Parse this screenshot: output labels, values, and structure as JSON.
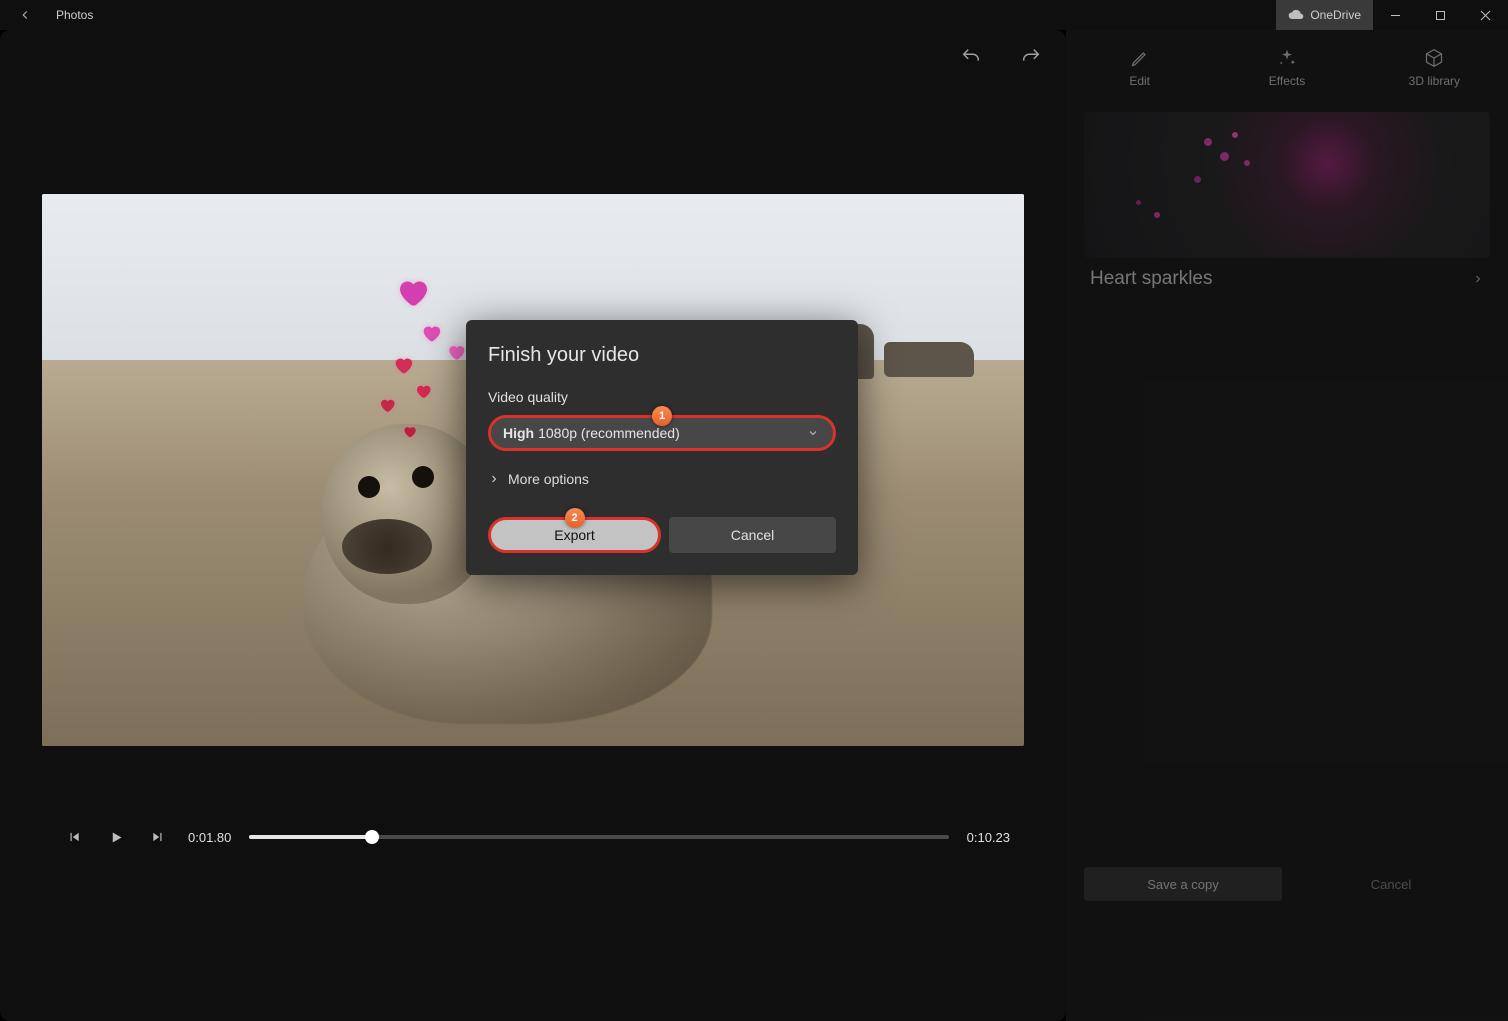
{
  "titlebar": {
    "app_name": "Photos",
    "cloud_label": "OneDrive"
  },
  "toolbar": {
    "undo": "Undo",
    "redo": "Redo"
  },
  "player": {
    "current_time": "0:01.80",
    "total_time": "0:10.23"
  },
  "panel": {
    "tabs": {
      "edit": "Edit",
      "effects": "Effects",
      "library3d": "3D library"
    },
    "effect_name": "Heart sparkles",
    "footer": {
      "save": "Save a copy",
      "cancel": "Cancel"
    }
  },
  "modal": {
    "title": "Finish your video",
    "quality_label": "Video quality",
    "quality_bold": "High",
    "quality_rest": "1080p (recommended)",
    "more_options": "More options",
    "export": "Export",
    "cancel": "Cancel",
    "badge1": "1",
    "badge2": "2"
  }
}
